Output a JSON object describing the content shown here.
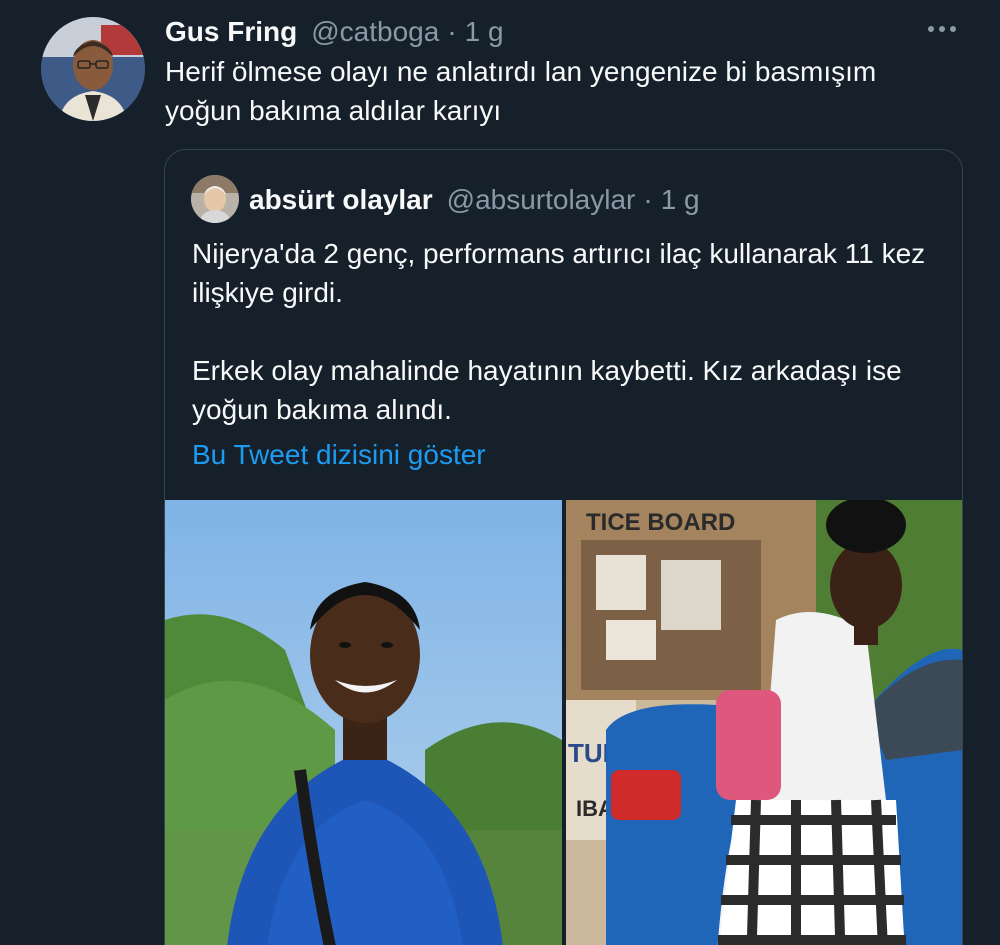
{
  "tweet": {
    "display_name": "Gus Fring",
    "handle": "@catboga",
    "separator": "·",
    "time": "1 g",
    "text": "Herif ölmese olayı ne anlatırdı lan yengenize bi basmışım yoğun bakıma aldılar karıyı",
    "more_icon": "more-horizontal-icon"
  },
  "quote": {
    "display_name": "absürt olaylar",
    "handle": "@absurtolaylar",
    "separator": "·",
    "time": "1 g",
    "paragraph_1": "Nijerya'da 2 genç, performans artırıcı ilaç kullanarak 11 kez ilişkiye girdi.",
    "paragraph_2": "Erkek olay mahalinde hayatının kaybetti. Kız arkadaşı ise yoğun bakıma alındı.",
    "thread_link": "Bu Tweet dizisini göster",
    "photo_right_sign": "TICE BOARD",
    "photo_right_sign_2": "TUD",
    "photo_right_sign_3": "IBA"
  },
  "colors": {
    "background": "#15202b",
    "text": "#f7f9f9",
    "secondary": "#8b98a5",
    "link": "#1d9bf0",
    "border": "#38444d"
  }
}
